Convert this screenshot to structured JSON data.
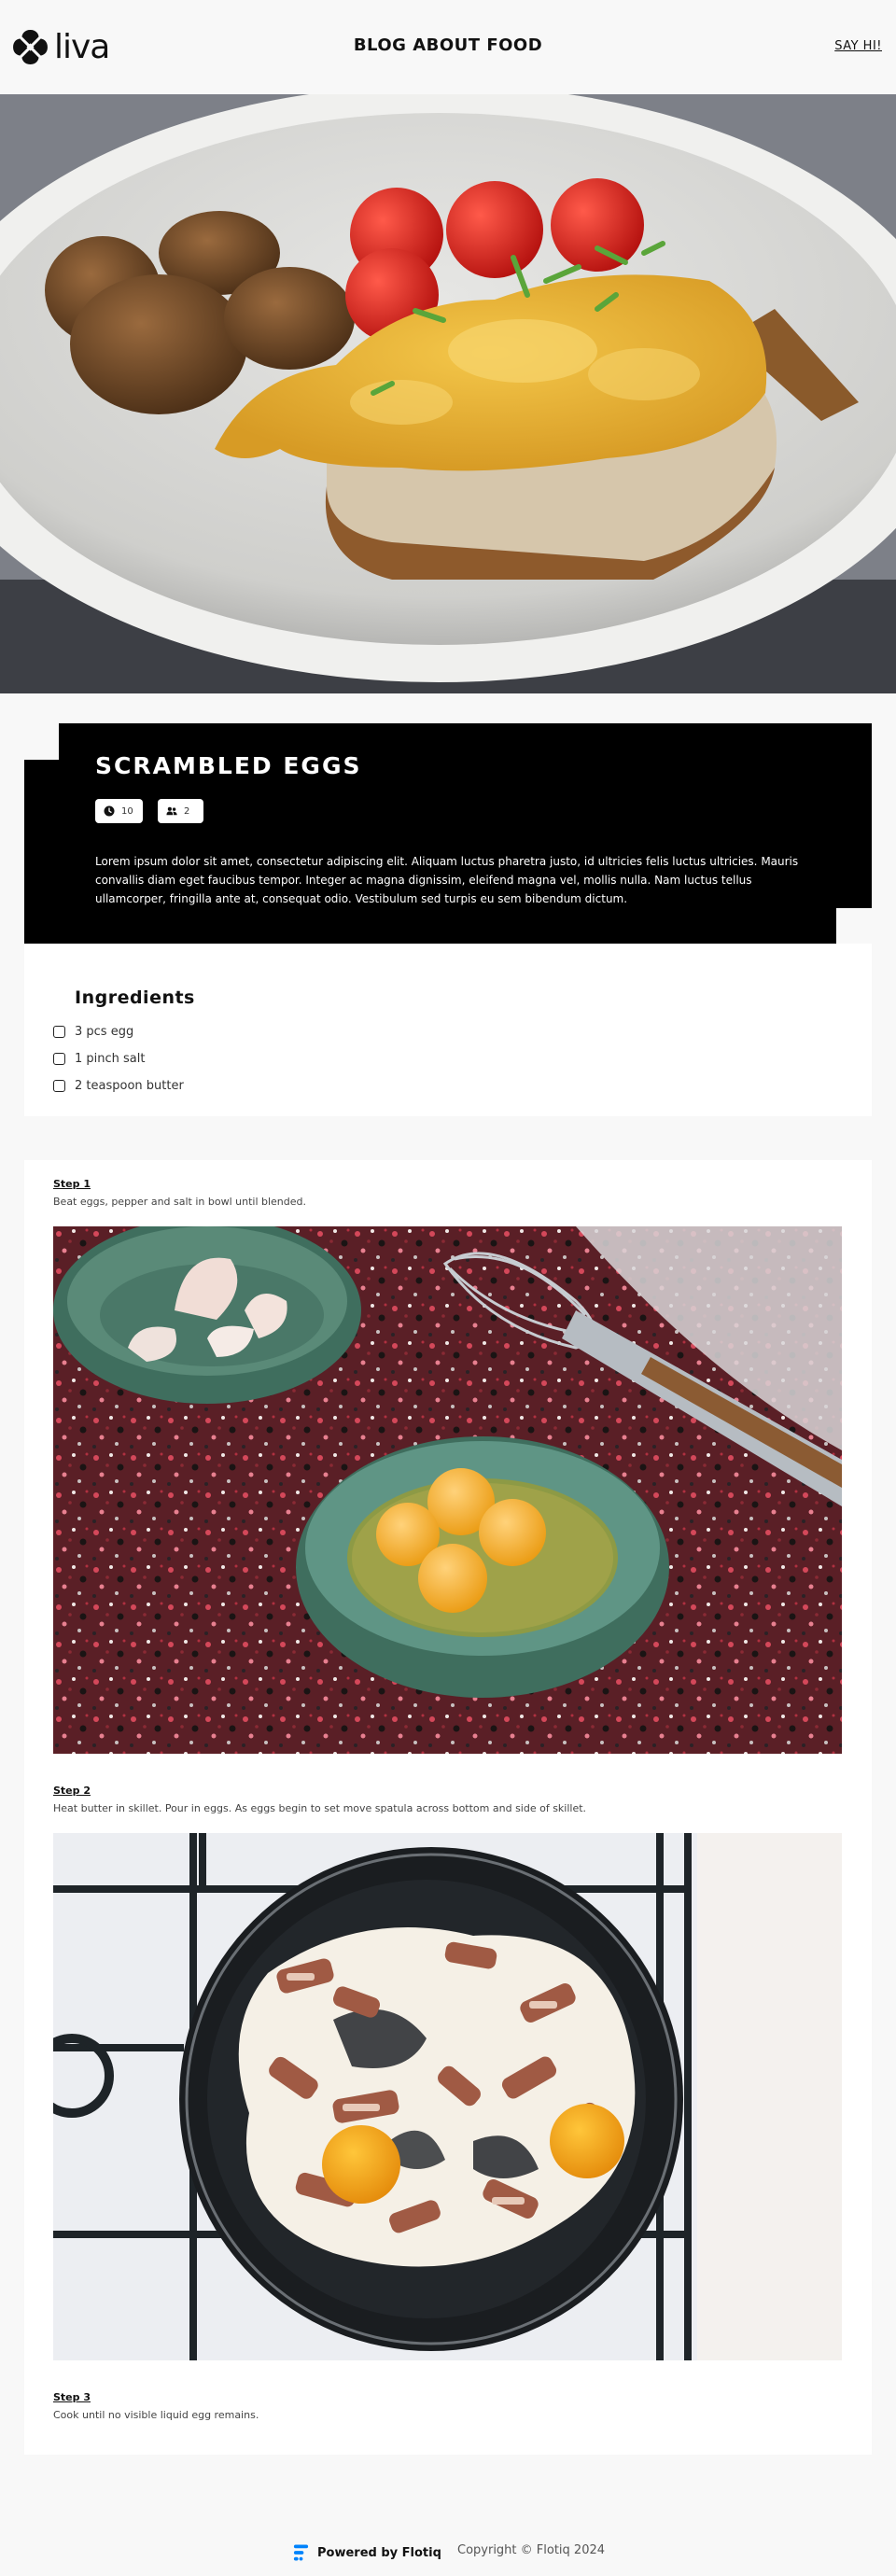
{
  "header": {
    "logo_text": "liva",
    "site_title": "BLOG ABOUT FOOD",
    "contact_link": "SAY HI!"
  },
  "recipe": {
    "title": "SCRAMBLED EGGS",
    "cooking_time": "10",
    "servings": "2",
    "description": "Lorem ipsum dolor sit amet, consectetur adipiscing elit. Aliquam luctus pharetra justo, id ultricies felis luctus ultricies. Mauris convallis diam eget faucibus tempor. Integer ac magna dignissim, eleifend magna vel, mollis nulla. Nam luctus tellus ullamcorper, fringilla ante at, consequat odio. Vestibulum sed turpis eu sem bibendum dictum."
  },
  "ingredients": {
    "title": "Ingredients",
    "items": [
      "3 pcs egg",
      "1 pinch salt",
      "2 teaspoon butter"
    ]
  },
  "steps": [
    {
      "label": "Step 1",
      "text": "Beat eggs, pepper and salt in bowl until blended."
    },
    {
      "label": "Step 2",
      "text": "Heat butter in skillet. Pour in eggs. As eggs begin to set move spatula across bottom and side of skillet."
    },
    {
      "label": "Step 3",
      "text": "Cook until no visible liquid egg remains."
    }
  ],
  "footer": {
    "powered_by": "Powered by Flotiq",
    "copyright": "Copyright © Flotiq 2024"
  },
  "icons": {
    "time": "clock-icon",
    "servings": "people-icon",
    "brand": "flotiq-logo-icon"
  },
  "colors": {
    "page_background": "#f8f8f8",
    "card_black": "#000000",
    "flotiq_blue": "#0083fc"
  }
}
